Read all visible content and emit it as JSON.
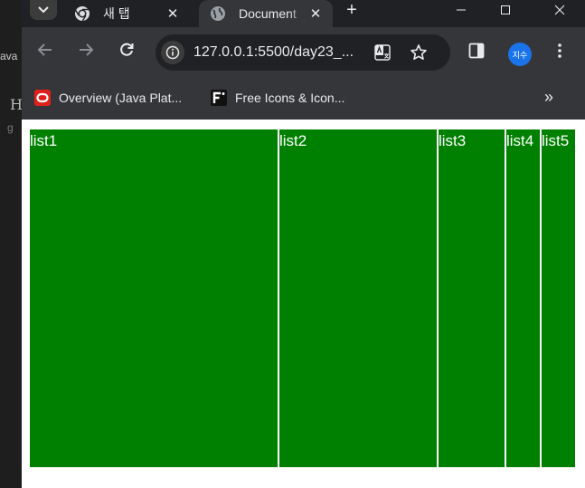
{
  "background_editor": {
    "fragment_text": "ava",
    "heading_char": "H",
    "faint_char": "g"
  },
  "browser": {
    "tabs": [
      {
        "title": "새 탭",
        "icon": "chrome-icon"
      },
      {
        "title": "Document",
        "icon": "globe-icon",
        "active": true
      }
    ],
    "close_glyph": "✕",
    "new_tab_glyph": "+",
    "address_bar": {
      "url": "127.0.0.1:5500/day23_..."
    },
    "profile": {
      "initials": "지수",
      "color": "#1a73e8"
    },
    "bookmarks": [
      {
        "label": "Overview (Java Plat...",
        "icon": "oracle-icon"
      },
      {
        "label": "Free Icons & Icon...",
        "icon": "flaticon-icon"
      }
    ],
    "more_bookmarks_glyph": "»"
  },
  "page": {
    "list_color": "#008000",
    "items": [
      "list1",
      "list2",
      "list3",
      "list4",
      "list5"
    ]
  }
}
